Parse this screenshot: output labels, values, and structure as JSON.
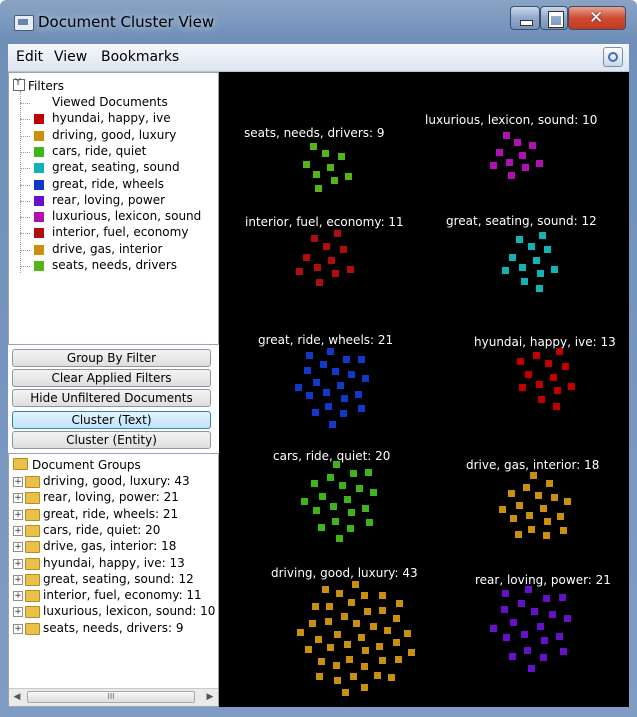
{
  "window": {
    "title": "Document Cluster View",
    "icons": {
      "app": "app-window-icon",
      "minimize": "minimize-icon",
      "maximize": "maximize-icon",
      "close": "close-icon"
    }
  },
  "menu": {
    "items": [
      "Edit",
      "View",
      "Bookmarks"
    ],
    "right_icon": "refresh-globe-icon"
  },
  "filters": {
    "title": "Filters",
    "icon": "funnel-icon",
    "rows": [
      {
        "label": "Viewed Documents",
        "color": null
      },
      {
        "label": "hyundai, happy, ive",
        "color": "#c00000"
      },
      {
        "label": "driving, good, luxury",
        "color": "#c8900c"
      },
      {
        "label": "cars, ride, quiet",
        "color": "#3fb41a"
      },
      {
        "label": "great, seating, sound",
        "color": "#12b3b3"
      },
      {
        "label": "great, ride, wheels",
        "color": "#1238c8"
      },
      {
        "label": "rear, loving, power",
        "color": "#6412c8"
      },
      {
        "label": "luxurious, lexicon, sound",
        "color": "#b010b0"
      },
      {
        "label": "interior, fuel, economy",
        "color": "#b00d0d"
      },
      {
        "label": "drive, gas, interior",
        "color": "#c8900c"
      },
      {
        "label": "seats, needs, drivers",
        "color": "#55b41a"
      }
    ]
  },
  "buttons": {
    "group_by_filter": "Group By Filter",
    "clear_filters": "Clear Applied Filters",
    "hide_unfiltered": "Hide Unfiltered Documents",
    "cluster_text": "Cluster (Text)",
    "cluster_entity": "Cluster (Entity)"
  },
  "groups": {
    "root_label": "Document Groups",
    "rows": [
      "driving, good, luxury: 43",
      "rear, loving, power: 21",
      "great, ride, wheels: 21",
      "cars, ride, quiet: 20",
      "drive, gas, interior: 18",
      "hyundai, happy, ive: 13",
      "great, seating, sound: 12",
      "interior, fuel, economy: 11",
      "luxurious, lexicon, sound: 10",
      "seats, needs, drivers: 9"
    ],
    "scroll_thumb_glyph": "III"
  },
  "clusters": [
    {
      "label": "seats, needs, drivers: 9",
      "count": 9,
      "color": "#55b41a"
    },
    {
      "label": "luxurious, lexicon, sound: 10",
      "count": 10,
      "color": "#b010b0"
    },
    {
      "label": "interior, fuel, economy: 11",
      "count": 11,
      "color": "#b00d0d"
    },
    {
      "label": "great, seating, sound: 12",
      "count": 12,
      "color": "#12b3b3"
    },
    {
      "label": "great, ride, wheels: 21",
      "count": 21,
      "color": "#1238c8"
    },
    {
      "label": "hyundai, happy, ive: 13",
      "count": 13,
      "color": "#c00000"
    },
    {
      "label": "cars, ride, quiet: 20",
      "count": 20,
      "color": "#3fb41a"
    },
    {
      "label": "drive, gas, interior: 18",
      "count": 18,
      "color": "#c8900c"
    },
    {
      "label": "driving, good, luxury: 43",
      "count": 43,
      "color": "#c8900c"
    },
    {
      "label": "rear, loving, power: 21",
      "count": 21,
      "color": "#6412c8"
    }
  ]
}
